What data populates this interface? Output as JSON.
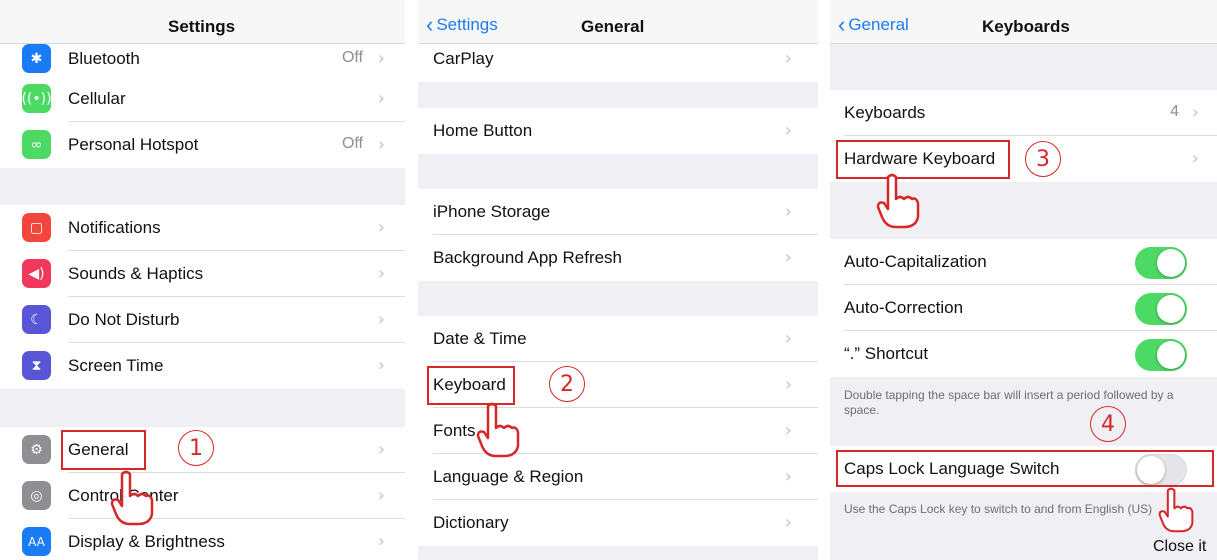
{
  "panel1": {
    "title": "Settings",
    "rows": [
      {
        "label": "Bluetooth",
        "value": "Off",
        "icon": "bluetooth-icon",
        "color": "#1a7cf5"
      },
      {
        "label": "Cellular",
        "value": "",
        "icon": "antenna-icon",
        "color": "#4cd964"
      },
      {
        "label": "Personal Hotspot",
        "value": "Off",
        "icon": "hotspot-icon",
        "color": "#4cd964"
      },
      {
        "label": "Notifications",
        "value": "",
        "icon": "notifications-icon",
        "color": "#f2453d"
      },
      {
        "label": "Sounds & Haptics",
        "value": "",
        "icon": "speaker-icon",
        "color": "#f2385a"
      },
      {
        "label": "Do Not Disturb",
        "value": "",
        "icon": "moon-icon",
        "color": "#5856d6"
      },
      {
        "label": "Screen Time",
        "value": "",
        "icon": "hourglass-icon",
        "color": "#5856d6"
      },
      {
        "label": "General",
        "value": "",
        "icon": "gear-icon",
        "color": "#8e8e93"
      },
      {
        "label": "Control Center",
        "value": "",
        "icon": "toggles-icon",
        "color": "#8e8e93"
      },
      {
        "label": "Display & Brightness",
        "value": "",
        "icon": "text-size-icon",
        "color": "#1a7cf5"
      }
    ],
    "step": "1"
  },
  "panel2": {
    "back": "Settings",
    "title": "General",
    "rows": [
      "CarPlay",
      "Home Button",
      "iPhone Storage",
      "Background App Refresh",
      "Date & Time",
      "Keyboard",
      "Fonts",
      "Language & Region",
      "Dictionary"
    ],
    "step": "2"
  },
  "panel3": {
    "back": "General",
    "title": "Keyboards",
    "keyboards_label": "Keyboards",
    "keyboards_count": "4",
    "hardware_label": "Hardware Keyboard",
    "step3": "3",
    "auto_cap": "Auto-Capitalization",
    "auto_corr": "Auto-Correction",
    "shortcut": "“.” Shortcut",
    "period_note": "Double tapping the space bar will insert a period followed by a space.",
    "step4": "4",
    "caps_lock": "Caps Lock Language Switch",
    "caps_note": "Use the Caps Lock key to switch to and from English (US)",
    "close_it": "Close it"
  },
  "colors": {
    "accent": "#1a7cf5",
    "switch_on": "#4cd964",
    "annotation": "#d62828"
  }
}
